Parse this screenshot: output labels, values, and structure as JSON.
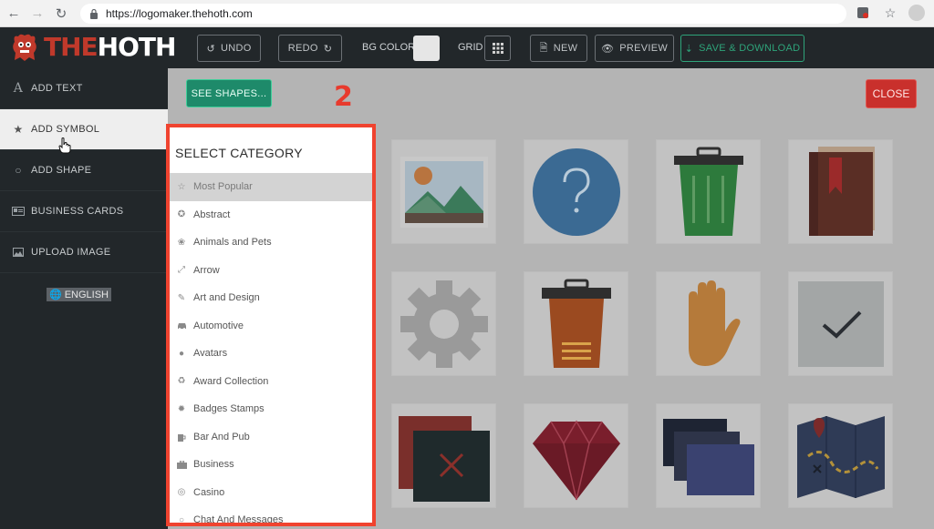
{
  "browser": {
    "url": "https://logomaker.thehoth.com"
  },
  "logo": {
    "part1": "THE",
    "part2": "HOTH"
  },
  "toolbar": {
    "undo": "UNDO",
    "redo": "REDO",
    "bg_color_label": "BG COLOR",
    "grid_label": "GRID",
    "new": "NEW",
    "preview": "PREVIEW",
    "save": "SAVE & DOWNLOAD",
    "bg_color_value": "#e6e6e6"
  },
  "sidebar": {
    "items": [
      {
        "label": "ADD TEXT",
        "icon": "text-icon"
      },
      {
        "label": "ADD SYMBOL",
        "icon": "star-icon"
      },
      {
        "label": "ADD SHAPE",
        "icon": "circle-icon"
      },
      {
        "label": "BUSINESS CARDS",
        "icon": "card-icon"
      },
      {
        "label": "UPLOAD IMAGE",
        "icon": "image-icon"
      }
    ],
    "language": "ENGLISH"
  },
  "main": {
    "see_shapes": "SEE SHAPES...",
    "close": "CLOSE",
    "step_marker": "2"
  },
  "category_panel": {
    "title": "SELECT CATEGORY",
    "items": [
      {
        "label": "Most Popular",
        "icon": "star-outline-icon"
      },
      {
        "label": "Abstract",
        "icon": "abstract-icon"
      },
      {
        "label": "Animals and Pets",
        "icon": "paw-icon"
      },
      {
        "label": "Arrow",
        "icon": "arrows-icon"
      },
      {
        "label": "Art and Design",
        "icon": "brush-icon"
      },
      {
        "label": "Automotive",
        "icon": "car-icon"
      },
      {
        "label": "Avatars",
        "icon": "person-icon"
      },
      {
        "label": "Award Collection",
        "icon": "trophy-icon"
      },
      {
        "label": "Badges Stamps",
        "icon": "badge-icon"
      },
      {
        "label": "Bar And Pub",
        "icon": "beer-icon"
      },
      {
        "label": "Business",
        "icon": "briefcase-icon"
      },
      {
        "label": "Casino",
        "icon": "casino-chip-icon"
      },
      {
        "label": "Chat And Messages",
        "icon": "chat-icon"
      }
    ]
  },
  "colors": {
    "accent_green": "#1e8a6a",
    "close_red": "#c9302c",
    "highlight_red": "#f0432f"
  }
}
